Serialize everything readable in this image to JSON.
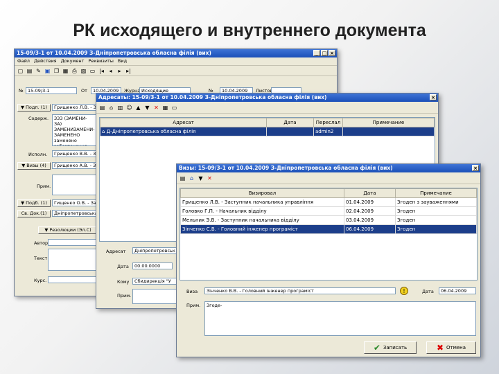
{
  "slide": {
    "title": "РК исходящего и внутреннего документа"
  },
  "win1": {
    "title": "15-09/3-1 от 10.04.2009 З-Дніпропетровська обласна філія (вих)",
    "menu": [
      "Файл",
      "Действия",
      "Документ",
      "Реквизиты",
      "Вид"
    ],
    "num_label": "№",
    "num_value": "15-09/3-1",
    "date_label": "От",
    "date_value": "10.04.2009",
    "reg_label": "Журнал",
    "reg_value": "Исходящие",
    "r_label": "№",
    "r_value": "10.04.2009",
    "sheets_label": "Листов",
    "podp_btn": "▼ Подп. (1)",
    "podp_value": "Грищенко Л.В. - Заступ",
    "content_label": "Содерж.",
    "content_value": "ЗЗЗ (ЗАМЕНИ-ЗА) ЗАМЕНИЗАМЕНИ-ЗАМЕНЕНО заменено забезпечення",
    "ispoln_label": "Исполн.",
    "ispoln_value": "Грищенко В.В. - Заступ",
    "vizy_btn": "▼ Визы (4)",
    "vizy_value": "Грищенко А.В. - Засту",
    "prim_label": "Прим.",
    "podbor_btn": "▼ Подб. (1)",
    "podbor_value": "Гищенко О.В. - Засту",
    "svyaz_btn": "Св. Док.(1)",
    "svyaz_value": "Дніпропетровська обл",
    "rez_btn": "▼ Резолюции (Эл.С)",
    "avtor_label": "Автор",
    "text_label": "Текст",
    "kurs_label": "Курс."
  },
  "win2": {
    "title": "Адресаты: 15-09/3-1 от 10.04.2009 З-Дніпропетровська обласна філія (вих)",
    "columns": [
      "Адресат",
      "Дата",
      "Переслал",
      "Примечание"
    ],
    "rows": [
      {
        "addressee": "Д-Дніпропетровська обласна філія",
        "date": "",
        "sender": "admin2",
        "note": ""
      }
    ],
    "adresat_label": "Адресат",
    "adresat_value": "Дніпропетровськ",
    "data_label": "Дата",
    "data_value": "00.00.0000",
    "komu_label": "Кому",
    "komu_value": "Сбидирекція \"У",
    "prim_label": "Прим."
  },
  "win3": {
    "title": "Визы: 15-09/3-1 от 10.04.2009 З-Дніпропетровська обласна філія (вих)",
    "columns": [
      "Визировал",
      "Дата",
      "Примечание"
    ],
    "rows": [
      {
        "person": "Грищенко Л.В. - Заступник начальника управління",
        "date": "01.04.2009",
        "note": "Згоден з зауваженнями"
      },
      {
        "person": "Головко Г.П. - Начальник відділу",
        "date": "02.04.2009",
        "note": "Згоден"
      },
      {
        "person": "Мельник Э.В. - Заступник начальника відділу",
        "date": "03.04.2009",
        "note": "Згоден"
      },
      {
        "person": "Зінченко С.В. - Головний інженер програміст",
        "date": "06.04.2009",
        "note": "Згоден"
      }
    ],
    "viza_label": "Виза",
    "viza_value": "Зінченко В.В. - Головний інженер програміст",
    "date_label": "Дата",
    "date_value": "06.04.2009",
    "prim_label": "Прим.",
    "prim_value": "Згоде-",
    "ok_label": "Записать",
    "cancel_label": "Отмена"
  },
  "colors": {
    "titlebar": "#1b4fb8",
    "window": "#ece9d8",
    "selection": "#1c3e8a"
  }
}
